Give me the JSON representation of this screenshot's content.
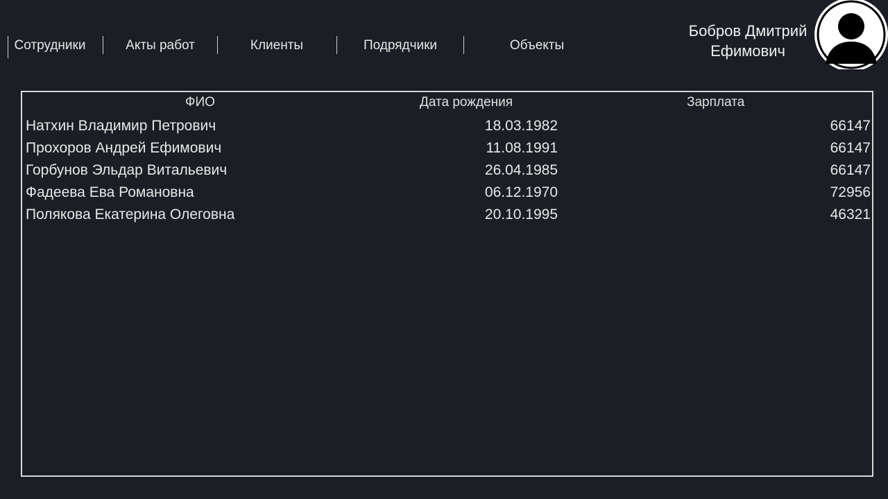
{
  "nav": {
    "items": [
      {
        "label": "Сотрудники"
      },
      {
        "label": "Акты работ"
      },
      {
        "label": "Клиенты"
      },
      {
        "label": "Подрядчики"
      },
      {
        "label": "Объекты"
      }
    ]
  },
  "user": {
    "name_line1": "Бобров Дмитрий",
    "name_line2": "Ефимович",
    "avatar_icon": "user-avatar-icon"
  },
  "table": {
    "headers": {
      "name": "ФИО",
      "birth_date": "Дата рождения",
      "salary": "Зарплата"
    },
    "rows": [
      {
        "name": "Натхин Владимир Петрович",
        "birth_date": "18.03.1982",
        "salary": "66147"
      },
      {
        "name": "Прохоров Андрей Ефимович",
        "birth_date": "11.08.1991",
        "salary": "66147"
      },
      {
        "name": "Горбунов Эльдар Витальевич",
        "birth_date": "26.04.1985",
        "salary": "66147"
      },
      {
        "name": "Фадеева Ева Романовна",
        "birth_date": "06.12.1970",
        "salary": "72956"
      },
      {
        "name": "Полякова Екатерина Олеговна",
        "birth_date": "20.10.1995",
        "salary": "46321"
      }
    ]
  },
  "colors": {
    "background": "#1b1e24",
    "text": "#e6e6e6",
    "border": "#d8d8d8"
  }
}
